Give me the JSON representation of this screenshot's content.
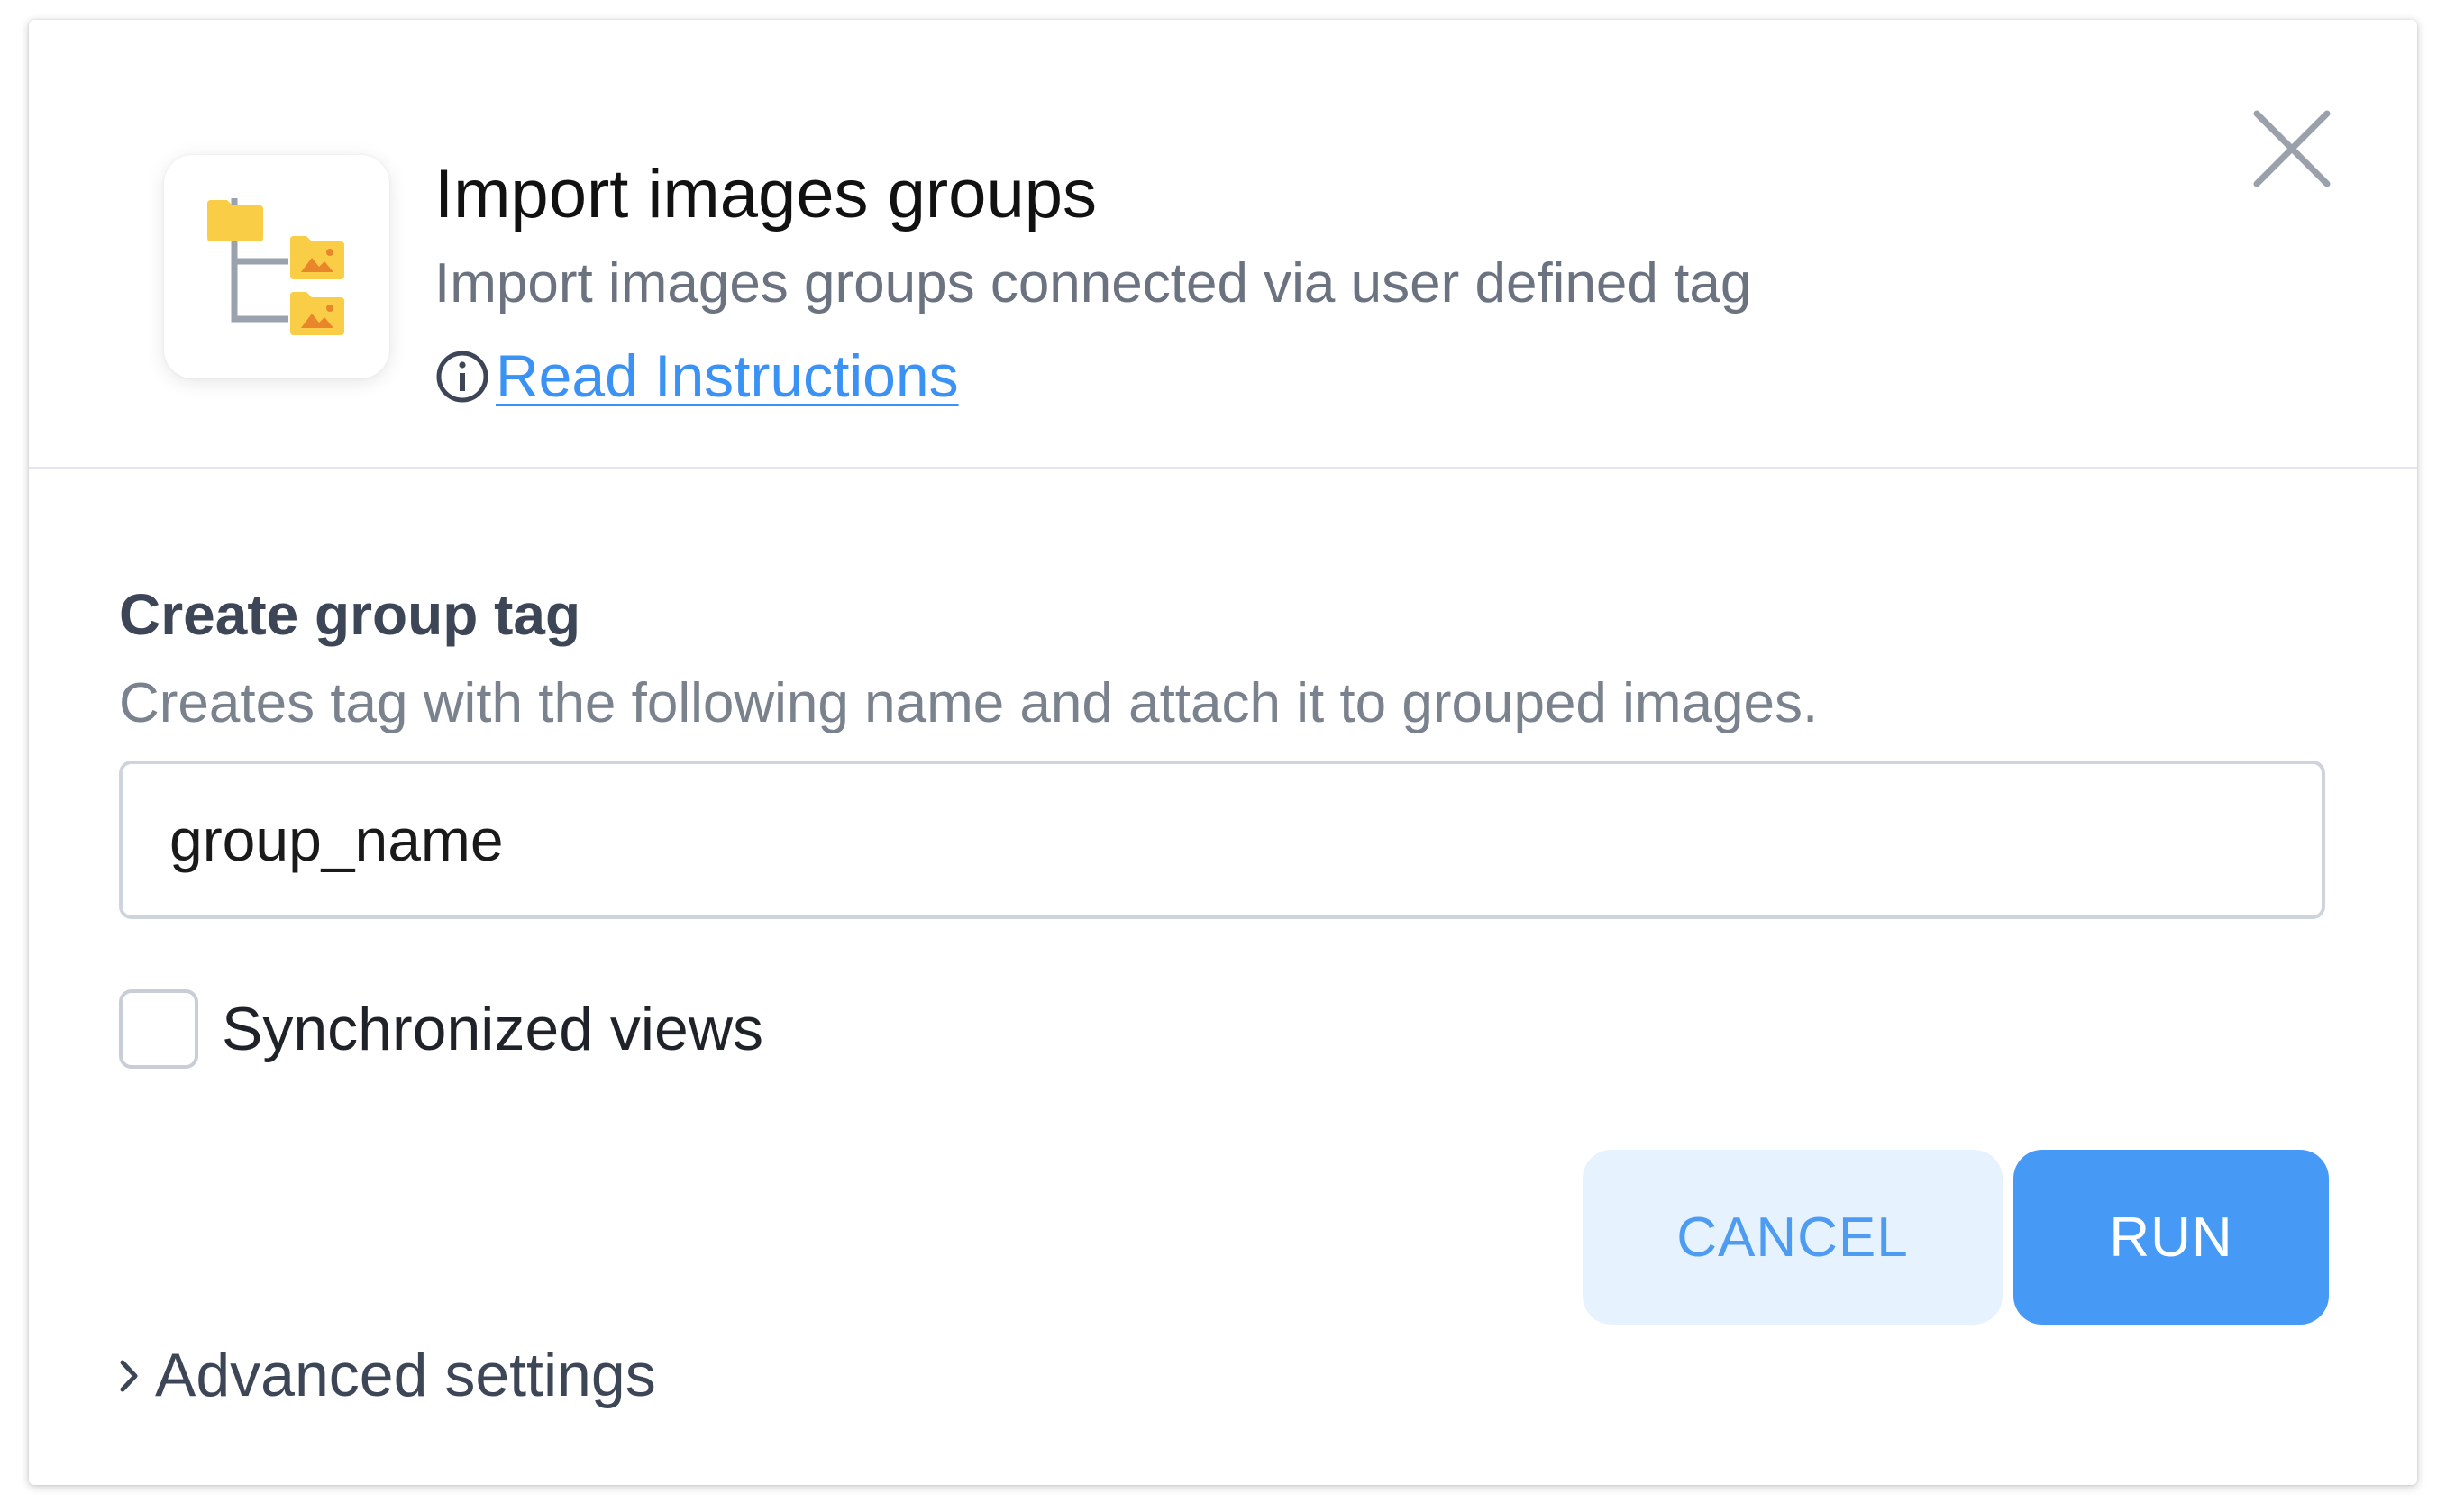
{
  "dialog": {
    "title": "Import images groups",
    "subtitle": "Import images groups connected via user defined tag",
    "instructions_link": "Read Instructions",
    "app_icon": "folder-tree-icon",
    "close_icon": "close-icon"
  },
  "form": {
    "group_tag": {
      "label": "Create group tag",
      "description": "Creates tag with the following name and attach it to grouped images.",
      "value": "group_name"
    },
    "sync_views": {
      "label": "Synchronized views",
      "checked": false
    },
    "advanced_settings_label": "Advanced settings"
  },
  "actions": {
    "cancel_label": "CANCEL",
    "run_label": "RUN"
  },
  "colors": {
    "accent": "#4799f6",
    "link": "#3b92f5",
    "cancel_bg": "#e6f2fd",
    "folder_yellow": "#f9cd46",
    "folder_orange": "#e9862b"
  }
}
